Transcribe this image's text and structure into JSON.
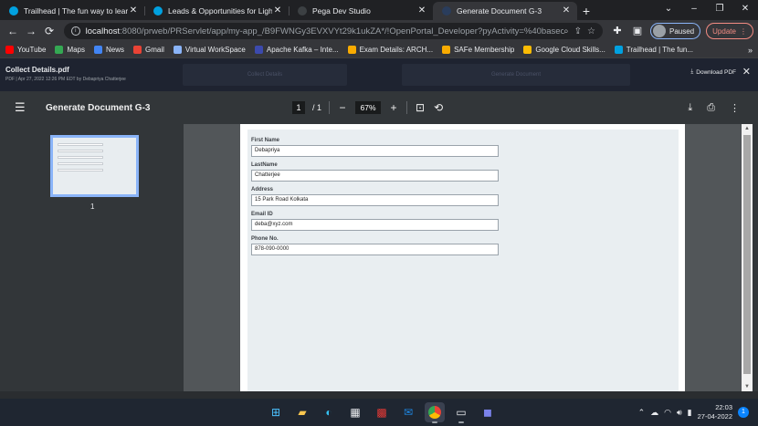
{
  "tabs": [
    {
      "label": "Trailhead | The fun way to learn",
      "color": "#00a1e0",
      "active": false
    },
    {
      "label": "Leads & Opportunities for Lightn",
      "color": "#00a1e0",
      "active": false
    },
    {
      "label": "Pega Dev Studio",
      "color": "#3c4043",
      "active": false
    },
    {
      "label": "Generate Document G-3",
      "color": "#2a3d5c",
      "active": true
    }
  ],
  "new_tab": "+",
  "window_controls": {
    "minimize": "–",
    "restore": "❐",
    "close": "✕"
  },
  "toolbar": {
    "back": "←",
    "forward": "→",
    "reload": "C",
    "url_host": "localhost",
    "url_path": ":8080/prweb/PRServlet/app/my-app_/B9FWNGy3EVXVYt29k1ukZA*/!OpenPortal_Developer?pyActivity=%40baseclas...",
    "paused_label": "Paused",
    "update_label": "Update"
  },
  "bookmarks": [
    {
      "label": "YouTube",
      "color": "#ff0000"
    },
    {
      "label": "Maps",
      "color": "#34a853"
    },
    {
      "label": "News",
      "color": "#4285f4"
    },
    {
      "label": "Gmail",
      "color": "#ea4335"
    },
    {
      "label": "Virtual WorkSpace",
      "color": "#8ab4f8"
    },
    {
      "label": "Apache Kafka – Inte...",
      "color": "#3c4aad"
    },
    {
      "label": "Exam Details: ARCH...",
      "color": "#f9ab00"
    },
    {
      "label": "SAFe Membership",
      "color": "#f9ab00"
    },
    {
      "label": "Google Cloud Skills...",
      "color": "#fbbc04"
    },
    {
      "label": "Trailhead | The fun...",
      "color": "#00a1e0"
    }
  ],
  "bookmarks_more": "»",
  "pdf_header": {
    "filename": "Collect Details.pdf",
    "meta": "PDF | Apr 27, 2022 12:26 PM EDT by Debapriya Chatterjee",
    "ghost_a": "Collect Details",
    "ghost_b": "Generate Document",
    "download_label": "Download PDF"
  },
  "pdf_toolbar": {
    "title": "Generate Document G-3",
    "page_current": "1",
    "page_total": "/ 1",
    "zoom": "67%"
  },
  "thumbnail_page": "1",
  "form_fields": [
    {
      "label": "First Name",
      "value": "Debapriya"
    },
    {
      "label": "LastName",
      "value": "Chatterjee"
    },
    {
      "label": "Address",
      "value": "15 Park Road Kolkata"
    },
    {
      "label": "Email ID",
      "value": "deba@xyz.com"
    },
    {
      "label": "Phone No.",
      "value": "878-090-0000"
    }
  ],
  "taskbar": {
    "time": "22:03",
    "date": "27-04-2022",
    "notifications": "1"
  }
}
